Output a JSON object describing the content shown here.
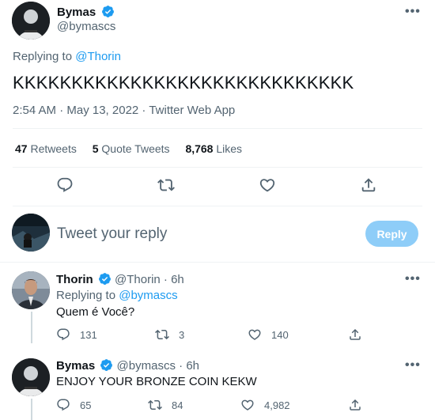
{
  "main_tweet": {
    "author_name": "Bymas",
    "author_handle": "@bymascs",
    "replying_label": "Replying to",
    "replying_to": "@Thorin",
    "text": "KKKKKKKKKKKKKKKKKKKKKKKKKKKKK",
    "meta": "2:54 AM · May 13, 2022 · Twitter Web App",
    "stats": {
      "retweets_count": "47",
      "retweets_label": "Retweets",
      "quotes_count": "5",
      "quotes_label": "Quote Tweets",
      "likes_count": "8,768",
      "likes_label": "Likes"
    }
  },
  "compose": {
    "placeholder": "Tweet your reply",
    "reply_button": "Reply"
  },
  "replies": [
    {
      "author_name": "Thorin",
      "author_handle": "@Thorin",
      "time": "6h",
      "replying_label": "Replying to",
      "replying_to": "@bymascs",
      "text": "Quem é Você?",
      "replies": "131",
      "retweets": "3",
      "likes": "140"
    },
    {
      "author_name": "Bymas",
      "author_handle": "@bymascs",
      "time": "6h",
      "text": "ENJOY YOUR BRONZE COIN KEKW",
      "replies": "65",
      "retweets": "84",
      "likes": "4,982"
    }
  ],
  "separator": "·",
  "more_glyph": "•••",
  "colors": {
    "accent": "#1d9bf0",
    "reply_button_disabled": "#8ecdf8",
    "text_primary": "#0f1419",
    "text_secondary": "#536471",
    "divider": "#eff3f4"
  }
}
